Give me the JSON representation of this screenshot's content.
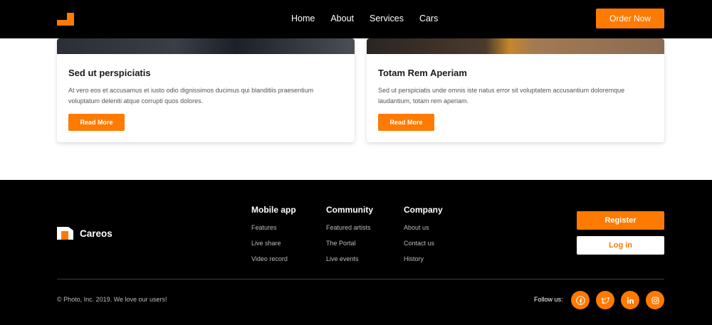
{
  "nav": {
    "links": [
      "Home",
      "About",
      "Services",
      "Cars"
    ],
    "order_label": "Order Now"
  },
  "cards": [
    {
      "title": "Sed ut perspiciatis",
      "text": "At vero eos et accusamus et iusto odio dignissimos ducimus qui blanditiis praesentium voluptatum deleniti atque corrupti quos dolores.",
      "button": "Read More"
    },
    {
      "title": "Totam Rem Aperiam",
      "text": "Sed ut perspiciatis unde omnis iste natus error sit voluptatem accusantium doloremque laudantium, totam rem aperiam.",
      "button": "Read More"
    }
  ],
  "footer": {
    "brand": "Careos",
    "columns": [
      {
        "title": "Mobile app",
        "links": [
          "Features",
          "Live share",
          "Video record"
        ]
      },
      {
        "title": "Community",
        "links": [
          "Featured artists",
          "The Portal",
          "Live events"
        ]
      },
      {
        "title": "Company",
        "links": [
          "About us",
          "Contact us",
          "History"
        ]
      }
    ],
    "register_label": "Register",
    "login_label": "Log in",
    "copyright": "© Photo, Inc. 2019. We love our users!",
    "follow_label": "Follow us:",
    "social_icons": [
      "facebook-icon",
      "twitter-icon",
      "linkedin-icon",
      "instagram-icon"
    ]
  },
  "colors": {
    "accent": "#ff7a00",
    "background_dark": "#000000"
  }
}
